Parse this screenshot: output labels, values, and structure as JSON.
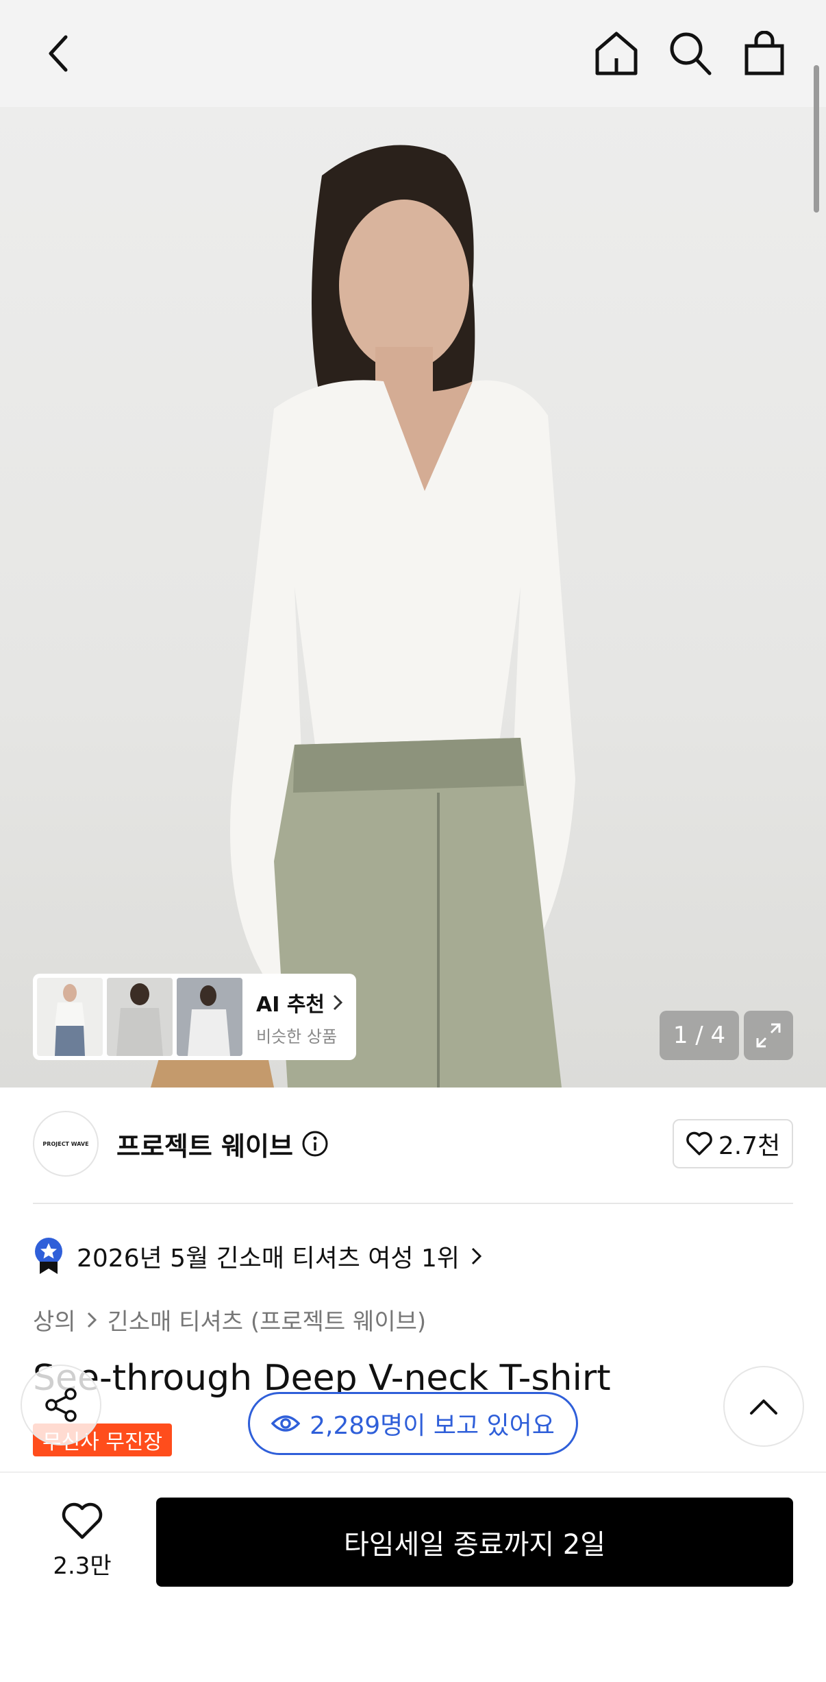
{
  "header": {
    "back_icon": "chevron-left-icon",
    "home_icon": "home-icon",
    "search_icon": "search-icon",
    "bag_icon": "shopping-bag-icon"
  },
  "gallery": {
    "counter": "1 / 4",
    "expand_icon": "expand-icon",
    "ai_recommend": {
      "title": "AI 추천",
      "subtitle": "비슷한 상품"
    }
  },
  "brand": {
    "logo_text": "PROJECT WAVE",
    "name": "프로젝트 웨이브",
    "likes": "2.7천"
  },
  "ranking": {
    "text": "2026년 5월 긴소매 티셔츠 여성 1위"
  },
  "breadcrumb": {
    "category": "상의",
    "subcategory": "긴소매 티셔츠 (프로젝트 웨이브)"
  },
  "product": {
    "title": "See-through Deep V-neck T-shirt",
    "badge": "무신사 무진장"
  },
  "floating": {
    "viewers": "2,289명이 보고 있어요"
  },
  "bottom_bar": {
    "wishlist_count": "2.3만",
    "buy_label": "타임세일 종료까지 2일"
  },
  "colors": {
    "accent_blue": "#2f5fd9",
    "badge_orange": "#ff4d1c",
    "button_black": "#000000"
  }
}
